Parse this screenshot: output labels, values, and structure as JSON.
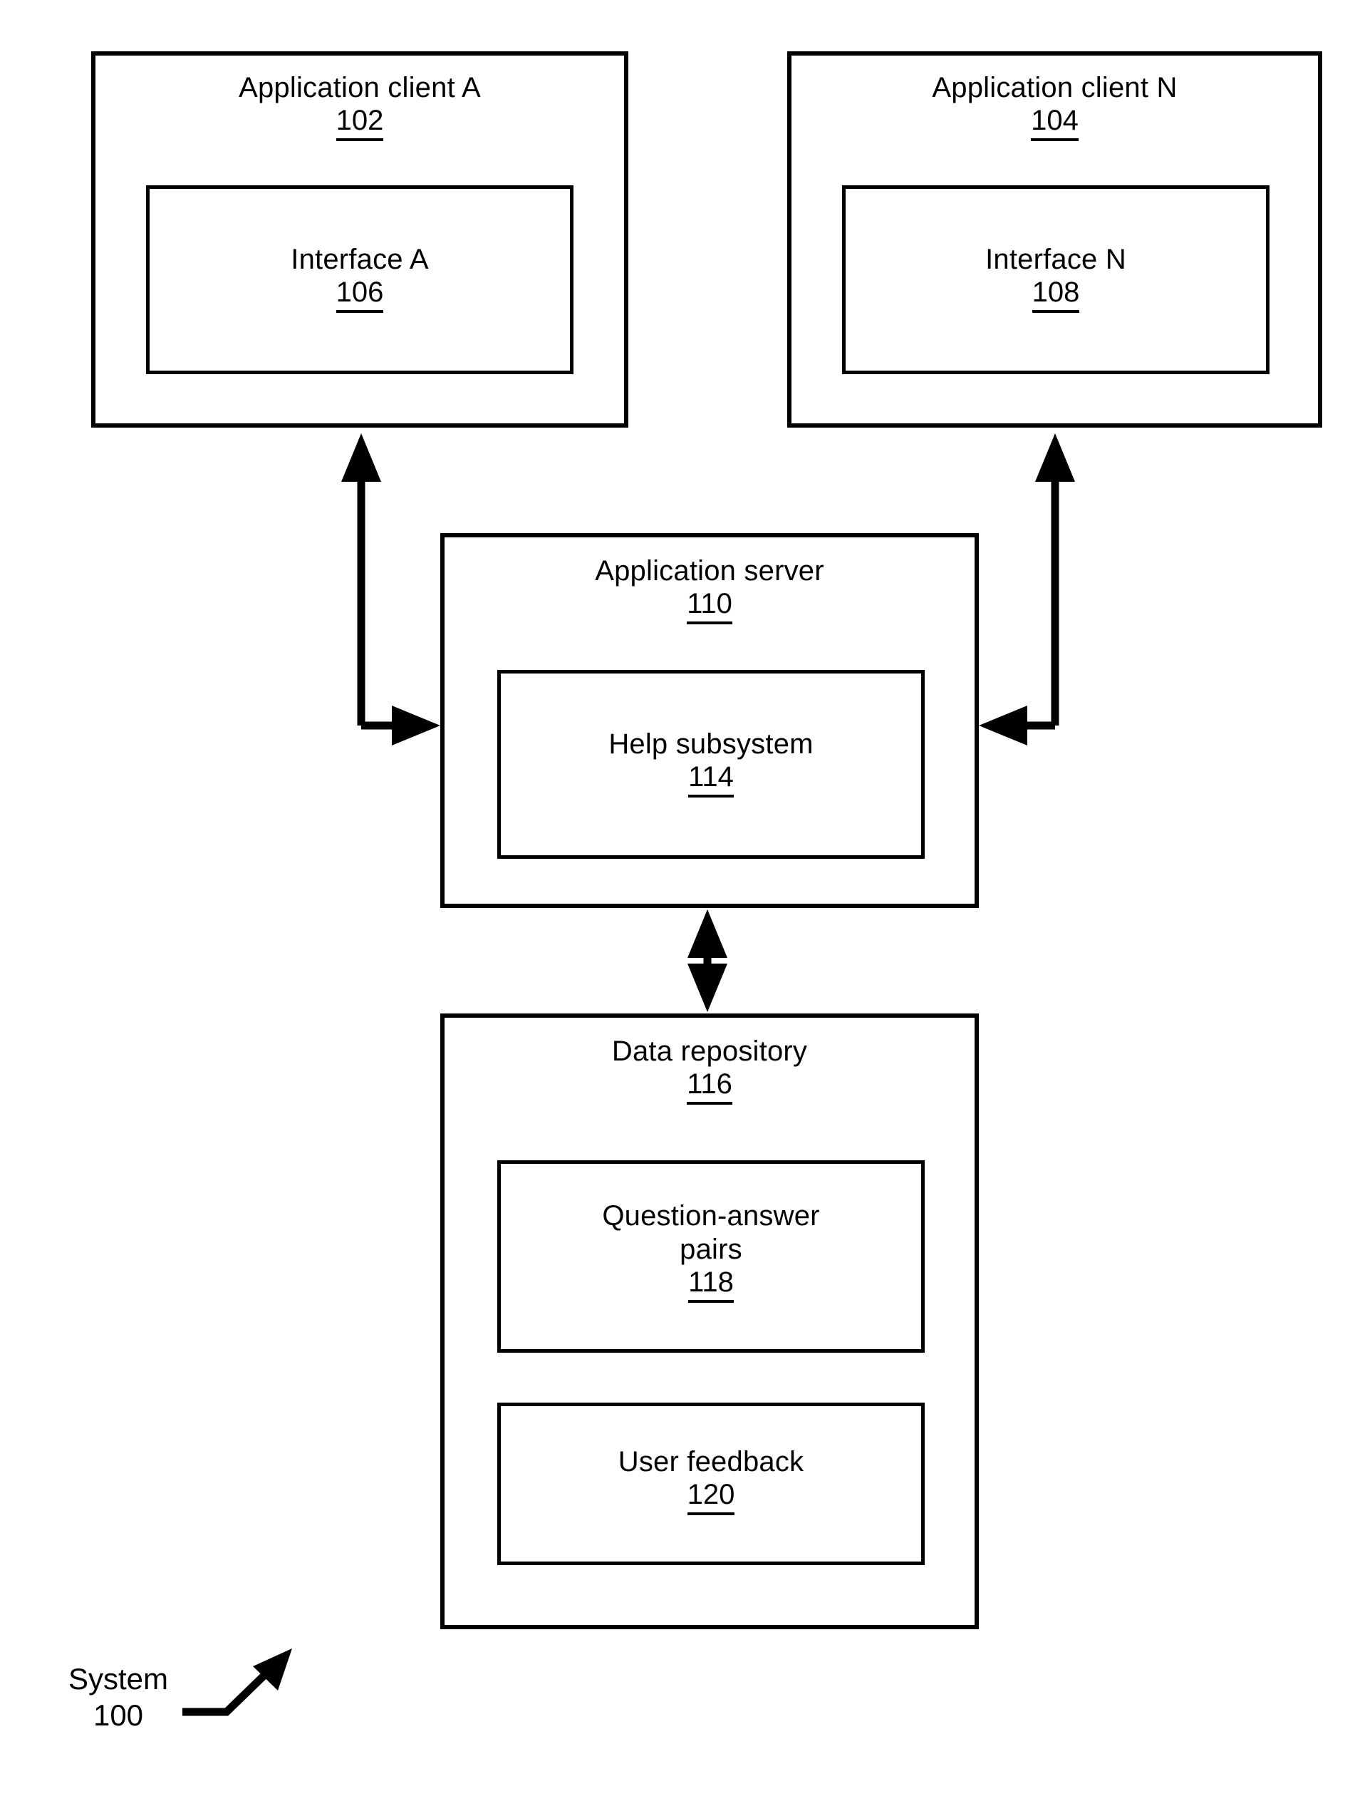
{
  "figure": {
    "kind": "patent-system-block-diagram",
    "caption_label": "System",
    "caption_ref": "100"
  },
  "nodes": {
    "application_client_a": {
      "label": "Application client A",
      "ref": "102"
    },
    "interface_a": {
      "label": "Interface A",
      "ref": "106"
    },
    "application_client_n": {
      "label": "Application client N",
      "ref": "104"
    },
    "interface_n": {
      "label": "Interface N",
      "ref": "108"
    },
    "application_server": {
      "label": "Application server",
      "ref": "110"
    },
    "help_subsystem": {
      "label": "Help subsystem",
      "ref": "114"
    },
    "data_repository": {
      "label": "Data repository",
      "ref": "116"
    },
    "question_answer_pairs": {
      "label": "Question-answer\npairs",
      "ref": "118"
    },
    "user_feedback": {
      "label": "User feedback",
      "ref": "120"
    }
  },
  "connectors": [
    {
      "name": "client-a-to-server",
      "from": "application_client_a",
      "to": "application_server",
      "style": "elbow",
      "arrows": "both"
    },
    {
      "name": "client-n-to-server",
      "from": "application_client_n",
      "to": "application_server",
      "style": "elbow",
      "arrows": "both"
    },
    {
      "name": "server-to-repository",
      "from": "application_server",
      "to": "data_repository",
      "style": "straight-vertical",
      "arrows": "both"
    },
    {
      "name": "system-callout-arrow",
      "from": "caption",
      "to": "figure",
      "style": "bent-leader",
      "arrows": "end"
    }
  ],
  "colors": {
    "stroke": "#000000",
    "background": "#ffffff",
    "text": "#000000"
  }
}
